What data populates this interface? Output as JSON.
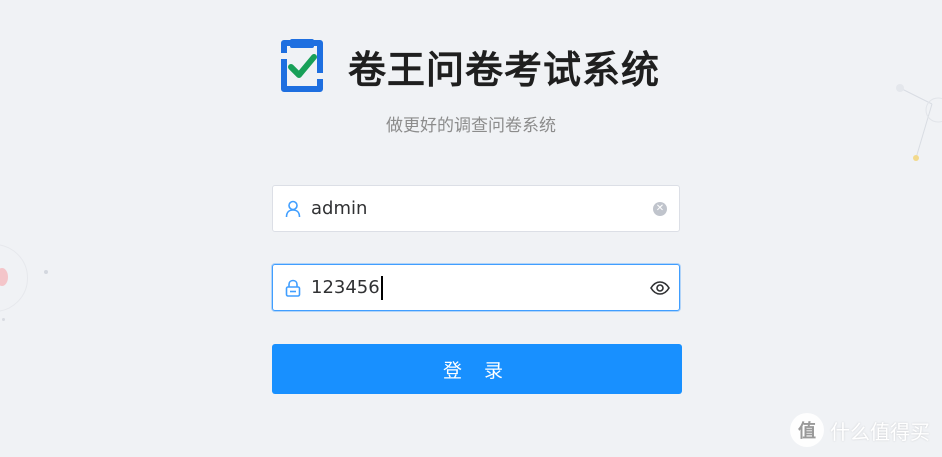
{
  "app": {
    "title": "卷王问卷考试系统",
    "subtitle": "做更好的调查问卷系统"
  },
  "login_form": {
    "username": {
      "value": "admin",
      "prefix_icon": "user-icon",
      "suffix_icon": "clear-icon"
    },
    "password": {
      "value": "123456",
      "prefix_icon": "lock-icon",
      "suffix_icon": "eye-icon"
    },
    "submit_label": "登 录"
  },
  "watermark": {
    "text": "什么值得买",
    "logo_glyph": "值"
  },
  "colors": {
    "primary": "#1890ff",
    "focus_border": "#409eff",
    "logo_blue": "#1e6fe0",
    "logo_check": "#18a058",
    "background": "#f0f2f5"
  }
}
